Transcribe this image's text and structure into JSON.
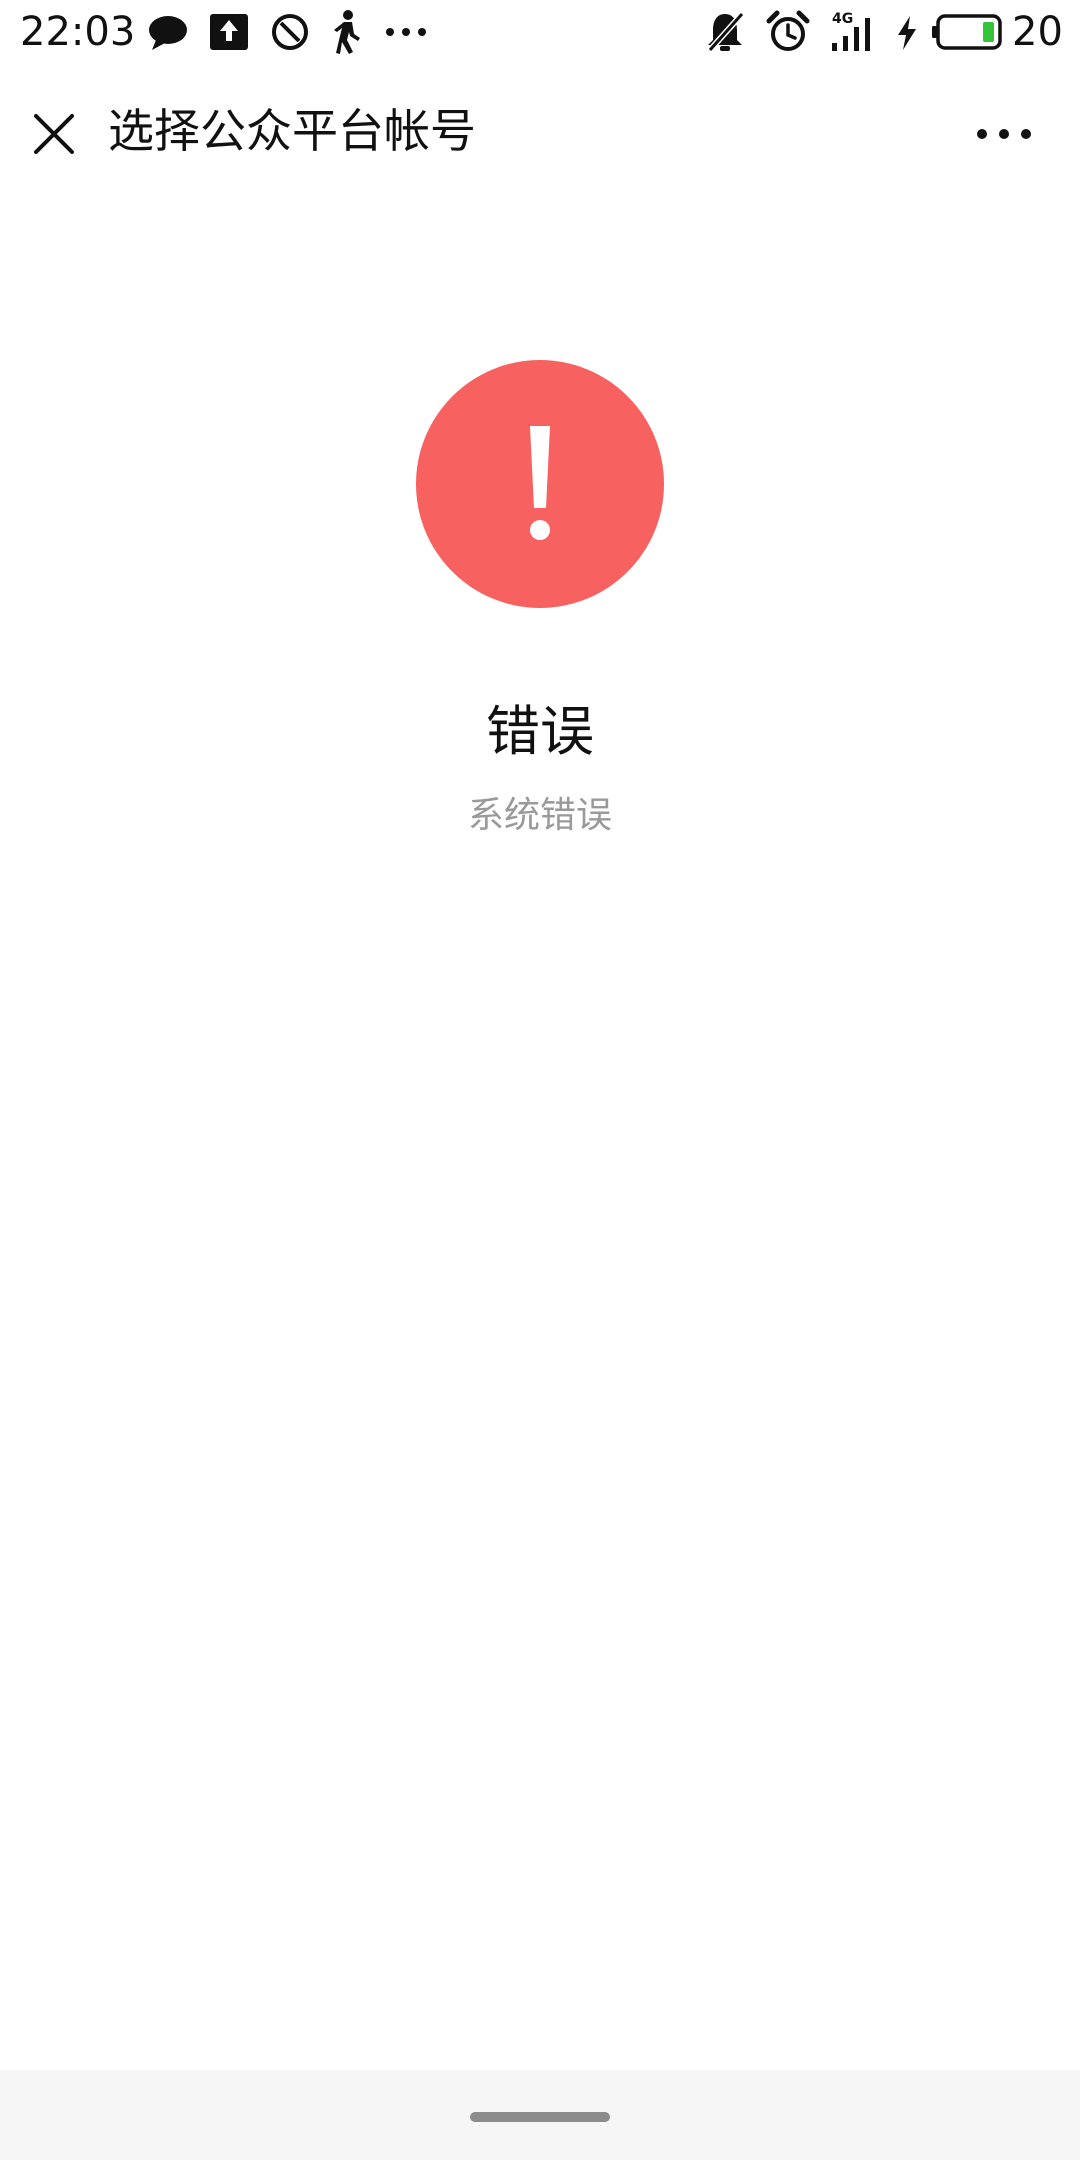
{
  "status_bar": {
    "time": "22:03",
    "battery_level": "20",
    "network_label": "4G",
    "left_icons": [
      "chat-bubble-icon",
      "upload-icon",
      "no-disturb-icon",
      "walking-icon",
      "more-dots-icon"
    ],
    "right_icons": [
      "bell-off-icon",
      "alarm-icon",
      "signal-icon",
      "charging-icon",
      "battery-icon"
    ],
    "battery_fill_color": "#35c43a"
  },
  "nav": {
    "title": "选择公众平台帐号",
    "close_icon": "close-icon",
    "more_icon": "more-icon"
  },
  "message": {
    "icon": "warning-icon",
    "icon_color": "#f76260",
    "title": "错误",
    "description": "系统错误"
  }
}
